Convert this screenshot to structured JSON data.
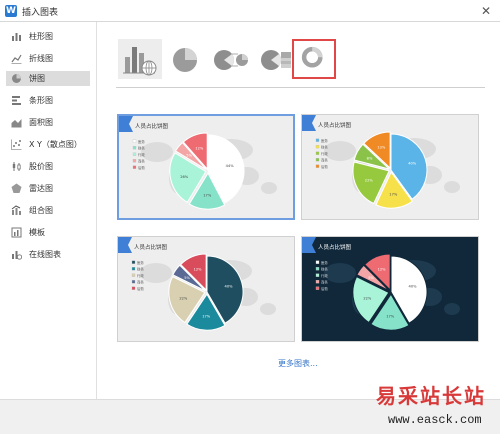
{
  "window": {
    "title": "插入图表",
    "app_icon": "W"
  },
  "sidebar": {
    "items": [
      {
        "label": "柱形图",
        "icon": "bar-chart-icon",
        "active": false
      },
      {
        "label": "折线图",
        "icon": "line-chart-icon",
        "active": false
      },
      {
        "label": "饼图",
        "icon": "pie-chart-icon",
        "active": true
      },
      {
        "label": "条形图",
        "icon": "horizontal-bar-icon",
        "active": false
      },
      {
        "label": "面积图",
        "icon": "area-chart-icon",
        "active": false
      },
      {
        "label": "X Y（散点图）",
        "icon": "scatter-chart-icon",
        "active": false
      },
      {
        "label": "股价图",
        "icon": "stock-chart-icon",
        "active": false
      },
      {
        "label": "雷达图",
        "icon": "radar-chart-icon",
        "active": false
      },
      {
        "label": "组合图",
        "icon": "combo-chart-icon",
        "active": false
      },
      {
        "label": "模板",
        "icon": "template-icon",
        "active": false
      },
      {
        "label": "在线图表",
        "icon": "online-chart-icon",
        "active": false
      }
    ]
  },
  "pie_types": [
    {
      "name": "chart-template-thumbnail"
    },
    {
      "name": "pie"
    },
    {
      "name": "pie-of-pie"
    },
    {
      "name": "bar-of-pie"
    },
    {
      "name": "doughnut",
      "selected": true
    }
  ],
  "templates": [
    {
      "title": "人员占比饼图",
      "theme": "light",
      "selected": true,
      "legend": [
        "医务",
        "财务",
        "行政",
        "商务",
        "后勤"
      ],
      "slices": [
        {
          "label": "44%",
          "color": "#ffffff"
        },
        {
          "label": "17%",
          "color": "#86e3c9"
        },
        {
          "label": "26%",
          "color": "#a9f4d9"
        },
        {
          "label": "5%",
          "color": "#f4a6a6"
        },
        {
          "label": "12%",
          "color": "#ee6b72"
        }
      ]
    },
    {
      "title": "人员占比饼图",
      "theme": "light",
      "selected": false,
      "legend": [
        "医务",
        "财务",
        "行政",
        "商务",
        "后勤"
      ],
      "slices": [
        {
          "label": "40%",
          "color": "#5ab4e8"
        },
        {
          "label": "17%",
          "color": "#f6e14a"
        },
        {
          "label": "22%",
          "color": "#96c93d"
        },
        {
          "label": "8%",
          "color": "#8bc34a"
        },
        {
          "label": "13%",
          "color": "#f08a24"
        }
      ]
    },
    {
      "title": "人员占比饼图",
      "theme": "light",
      "selected": false,
      "legend": [
        "医务",
        "财务",
        "行政",
        "商务",
        "后勤"
      ],
      "slices": [
        {
          "label": "40%",
          "color": "#1e4e5f"
        },
        {
          "label": "17%",
          "color": "#1b8a9c"
        },
        {
          "label": "22%",
          "color": "#d8d0b0"
        },
        {
          "label": "5%",
          "color": "#5a6a94"
        },
        {
          "label": "12%",
          "color": "#d94c5c"
        }
      ]
    },
    {
      "title": "人员占比饼图",
      "theme": "dark",
      "selected": false,
      "legend": [
        "医务",
        "财务",
        "行政",
        "商务",
        "后勤"
      ],
      "slices": [
        {
          "label": "40%",
          "color": "#ffffff"
        },
        {
          "label": "17%",
          "color": "#86e3c9"
        },
        {
          "label": "22%",
          "color": "#a9f4d9"
        },
        {
          "label": "5%",
          "color": "#f4a6a6"
        },
        {
          "label": "12%",
          "color": "#ee6b72"
        }
      ]
    }
  ],
  "more_link": "更多图表...",
  "watermark": {
    "text": "易采站长站",
    "url": "www.easck.com",
    "color": "#d83a3a"
  }
}
